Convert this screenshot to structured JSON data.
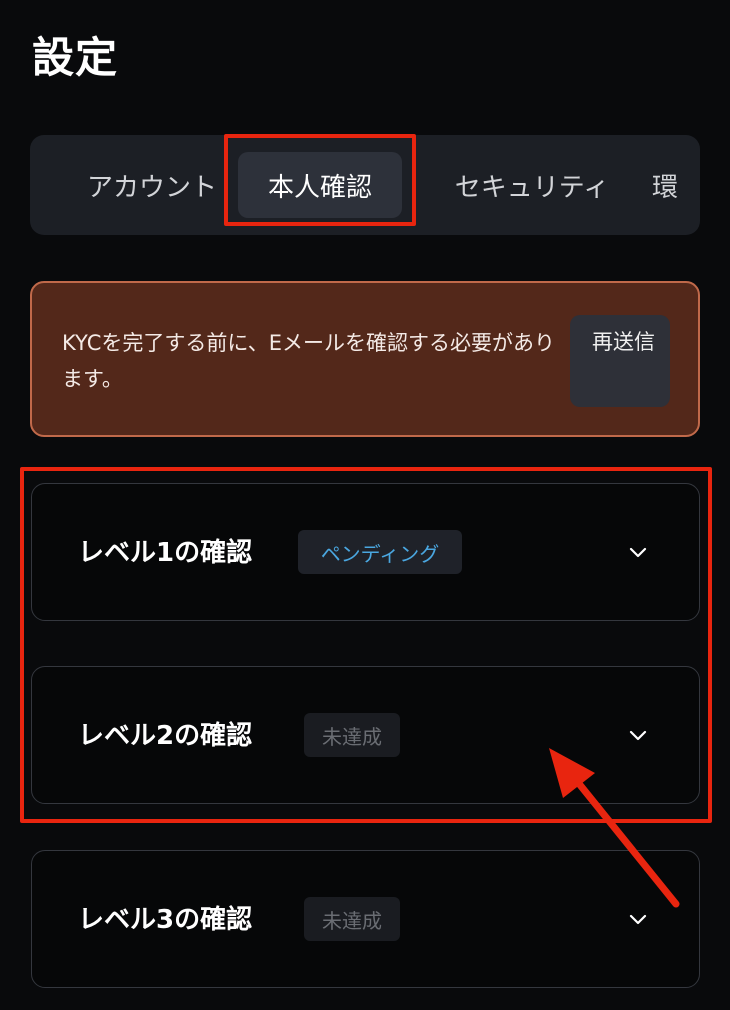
{
  "page": {
    "title": "設定"
  },
  "tabs": [
    {
      "label": "アカウント",
      "active": false
    },
    {
      "label": "本人確認",
      "active": true
    },
    {
      "label": "セキュリティ",
      "active": false
    },
    {
      "label": "環",
      "active": false
    }
  ],
  "alert": {
    "message": "KYCを完了する前に、Eメールを確認する必要があります。",
    "resend_label": "再送信",
    "colors": {
      "background": "#53281a",
      "border": "#c0694a"
    }
  },
  "levels": [
    {
      "title": "レベル1の確認",
      "status": "ペンディング",
      "status_color": "#4aa7e0",
      "icon": "chevron-down-icon"
    },
    {
      "title": "レベル2の確認",
      "status": "未達成",
      "status_color": "#6a6d73",
      "icon": "chevron-down-icon"
    },
    {
      "title": "レベル3の確認",
      "status": "未達成",
      "status_color": "#6a6d73",
      "icon": "chevron-down-icon"
    }
  ],
  "annotations": {
    "color": "#e8250f"
  }
}
